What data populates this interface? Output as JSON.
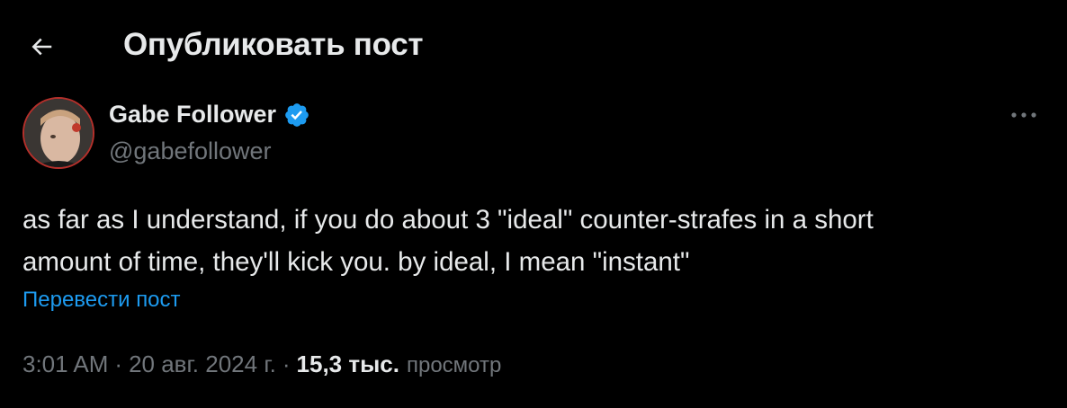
{
  "header": {
    "title": "Опубликовать пост",
    "back_icon": "arrow-left-icon"
  },
  "author": {
    "display_name": "Gabe Follower",
    "handle": "@gabefollower",
    "verified_icon": "verified-badge-icon",
    "verified_color": "#1d9bf0"
  },
  "post": {
    "text": "as far as I understand, if you do about 3 \"ideal\" counter-strafes in a short\namount of time, they'll kick you. by ideal, I mean \"instant\"",
    "translate_label": "Перевести пост"
  },
  "meta": {
    "time": "3:01 AM",
    "separator": "·",
    "date": "20 авг. 2024 г.",
    "views_count": "15,3 тыс.",
    "views_label": "просмотр"
  },
  "colors": {
    "background": "#000000",
    "text_primary": "#e7e9ea",
    "text_secondary": "#71767b",
    "accent": "#1d9bf0"
  }
}
